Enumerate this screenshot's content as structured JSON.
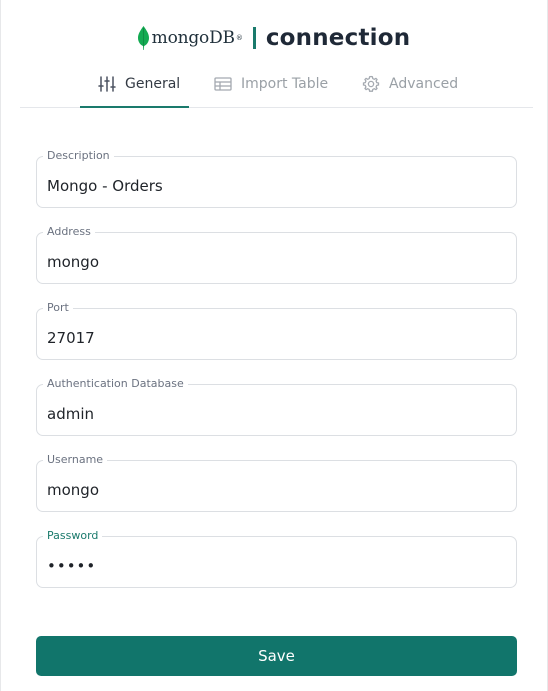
{
  "header": {
    "logo_text": "mongoDB",
    "logo_mark": "®",
    "title": "connection",
    "accent_color": "#1a7a6c"
  },
  "tabs": [
    {
      "label": "General",
      "icon": "sliders-icon",
      "active": true
    },
    {
      "label": "Import Table",
      "icon": "table-icon",
      "active": false
    },
    {
      "label": "Advanced",
      "icon": "gear-icon",
      "active": false
    }
  ],
  "form": {
    "description": {
      "label": "Description",
      "value": "Mongo - Orders"
    },
    "address": {
      "label": "Address",
      "value": "mongo"
    },
    "port": {
      "label": "Port",
      "value": "27017"
    },
    "auth_db": {
      "label": "Authentication Database",
      "value": "admin"
    },
    "username": {
      "label": "Username",
      "value": "mongo"
    },
    "password": {
      "label": "Password",
      "value": "•••••",
      "focused": true
    }
  },
  "actions": {
    "save_label": "Save",
    "save_color": "#11756b"
  }
}
